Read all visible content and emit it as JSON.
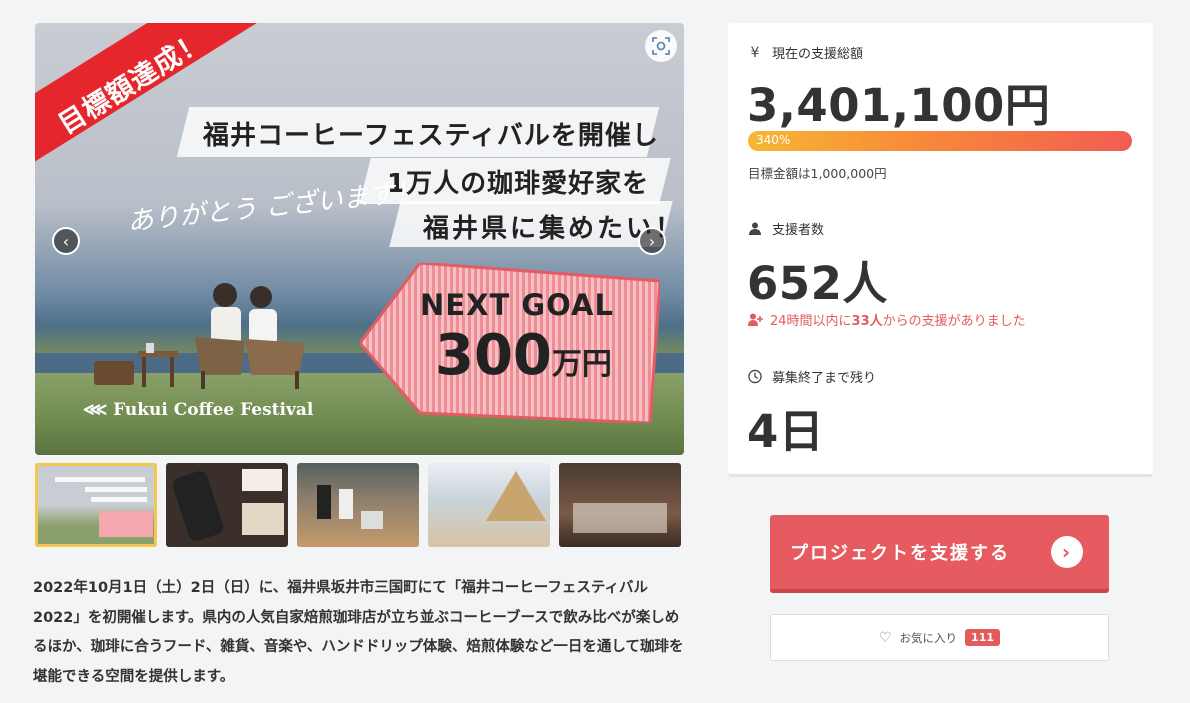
{
  "hero": {
    "ribbon": "目標額達成！",
    "headline_1": "福井コーヒーフェスティバルを開催し",
    "headline_2": "1万人の珈琲愛好家を",
    "headline_3": "福井県に集めたい！",
    "thanks": "ありがとう ございます！",
    "next_goal_label": "NEXT GOAL",
    "next_goal_value": "300",
    "next_goal_unit": "万円",
    "brand": "Fukui Coffee Festival"
  },
  "description": "2022年10月1日（土）2日（日）に、福井県坂井市三国町にて「福井コーヒーフェスティバル2022」を初開催します。県内の人気自家焙煎珈琲店が立ち並ぶコーヒーブースで飲み比べが楽しめるほか、珈琲に合うフード、雑貨、音楽や、ハンドドリップ体験、焙煎体験など一日を通して珈琲を堪能できる空間を提供します。",
  "stats": {
    "total_label": "現在の支援総額",
    "total_amount": "3,401,100円",
    "progress_percent": 340,
    "progress_label": "340%",
    "target_text": "目標金額は1,000,000円",
    "backers_label": "支援者数",
    "backers_count": "652人",
    "recent_prefix": "24時間以内に",
    "recent_count": "33人",
    "recent_suffix": "からの支援がありました",
    "remaining_label": "募集終了まで残り",
    "remaining_days": "4日"
  },
  "actions": {
    "support_label": "プロジェクトを支援する",
    "favorite_label": "お気に入り",
    "favorite_count": "111"
  },
  "colors": {
    "accent": "#e55b60",
    "ribbon": "#e6262d",
    "alert": "#e25c5c"
  }
}
